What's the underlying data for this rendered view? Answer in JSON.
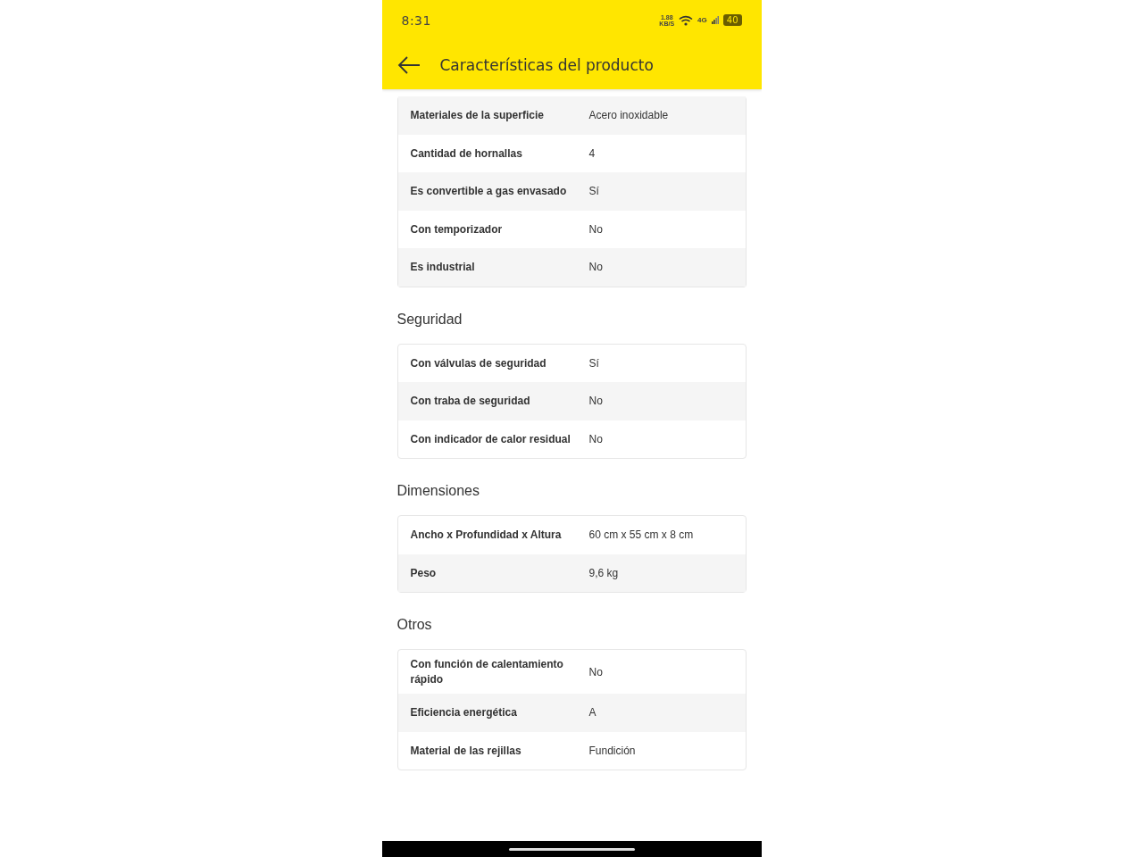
{
  "status_bar": {
    "time": "8:31",
    "speed": "1.88",
    "speed_unit": "KB/S",
    "network": "4G",
    "battery": "40"
  },
  "app_bar": {
    "title": "Características del producto"
  },
  "sections": [
    {
      "rows": [
        {
          "label": "Materiales de la superficie",
          "value": "Acero inoxidable"
        },
        {
          "label": "Cantidad de hornallas",
          "value": "4"
        },
        {
          "label": "Es convertible a gas envasado",
          "value": "Sí"
        },
        {
          "label": "Con temporizador",
          "value": "No"
        },
        {
          "label": "Es industrial",
          "value": "No"
        }
      ]
    },
    {
      "title": "Seguridad",
      "rows": [
        {
          "label": "Con válvulas de seguridad",
          "value": "Sí"
        },
        {
          "label": "Con traba de seguridad",
          "value": "No"
        },
        {
          "label": "Con indicador de calor residual",
          "value": "No"
        }
      ]
    },
    {
      "title": "Dimensiones",
      "rows": [
        {
          "label": "Ancho x Profundidad x Altura",
          "value": "60 cm x 55 cm x 8 cm"
        },
        {
          "label": "Peso",
          "value": "9,6 kg"
        }
      ]
    },
    {
      "title": "Otros",
      "rows": [
        {
          "label": "Con función de calentamiento rápido",
          "value": "No"
        },
        {
          "label": "Eficiencia energética",
          "value": "A"
        },
        {
          "label": "Material de las rejillas",
          "value": "Fundición"
        }
      ]
    }
  ]
}
